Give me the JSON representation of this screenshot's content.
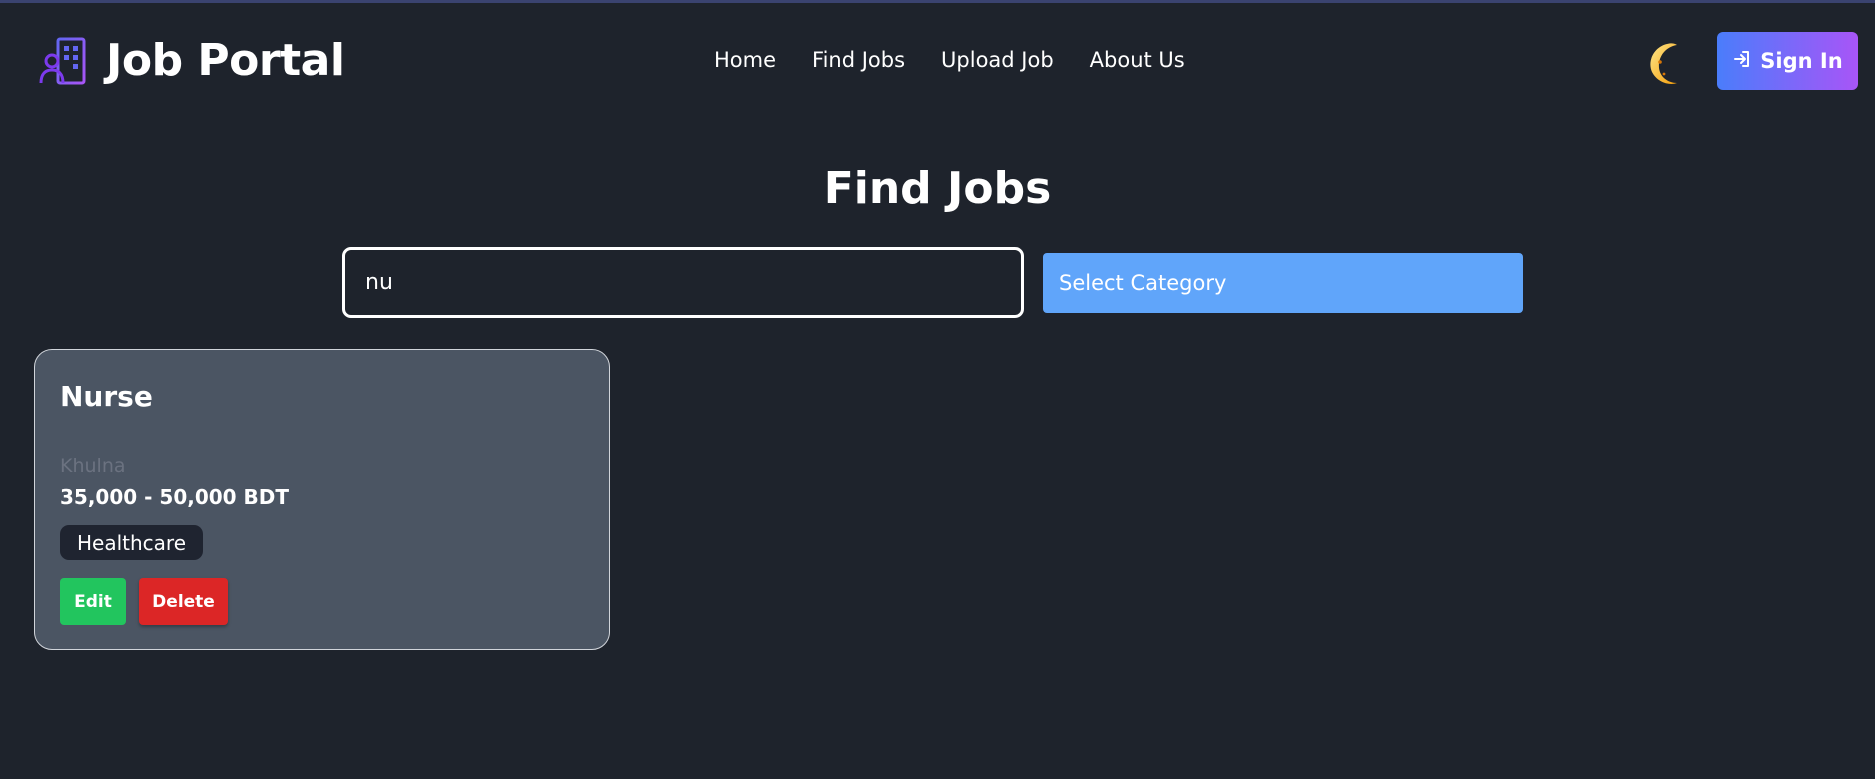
{
  "app": {
    "title": "Job Portal"
  },
  "nav": {
    "links": [
      "Home",
      "Find Jobs",
      "Upload Job",
      "About Us"
    ],
    "theme_icon": "moon-icon",
    "signin_label": "Sign In",
    "signin_icon": "sign-in-icon"
  },
  "page": {
    "title": "Find Jobs"
  },
  "search": {
    "value": "nu",
    "placeholder": ""
  },
  "category": {
    "selected": "Select Category"
  },
  "jobs": [
    {
      "title": "Nurse",
      "location": "Khulna",
      "salary": "35,000 - 50,000 BDT",
      "category": "Healthcare",
      "edit_label": "Edit",
      "delete_label": "Delete"
    }
  ],
  "colors": {
    "background": "#1e232c",
    "card": "#4b5563",
    "select": "#60a5fa",
    "edit": "#22c55e",
    "delete": "#dc2626",
    "signin_gradient_start": "#4a7dfb",
    "signin_gradient_end": "#a855f7"
  }
}
